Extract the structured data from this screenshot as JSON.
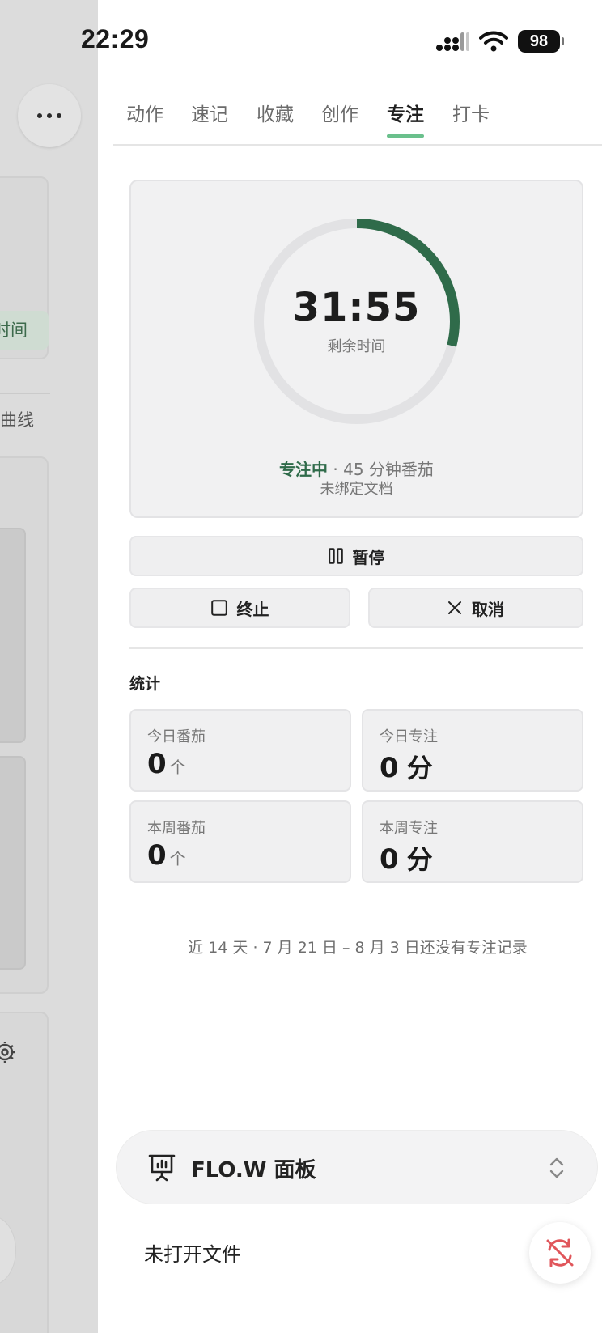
{
  "status_bar": {
    "time": "22:29",
    "battery": "98"
  },
  "background": {
    "chip_text": "时间",
    "label_text": "曲线"
  },
  "tabs": [
    {
      "label": "动作",
      "active": false
    },
    {
      "label": "速记",
      "active": false
    },
    {
      "label": "收藏",
      "active": false
    },
    {
      "label": "创作",
      "active": false
    },
    {
      "label": "专注",
      "active": true
    },
    {
      "label": "打卡",
      "active": false
    }
  ],
  "timer": {
    "remaining": "31:55",
    "remaining_label": "剩余时间",
    "progress_fraction": 0.29,
    "status_active": "专注中",
    "status_rest": " · 45 分钟番茄",
    "bound_doc": "未绑定文档"
  },
  "buttons": {
    "pause": "暂停",
    "stop": "终止",
    "cancel": "取消"
  },
  "stats": {
    "title": "统计",
    "items": [
      {
        "label": "今日番茄",
        "value": "0",
        "unit": "个"
      },
      {
        "label": "今日专注",
        "value": "0",
        "unit": "分"
      },
      {
        "label": "本周番茄",
        "value": "0",
        "unit": "个"
      },
      {
        "label": "本周专注",
        "value": "0",
        "unit": "分"
      }
    ]
  },
  "empty_note": "近 14 天 · 7 月 21 日 – 8 月 3 日还没有专注记录",
  "panel": {
    "title": "FLO.W 面板",
    "no_file": "未打开文件"
  },
  "colors": {
    "accent": "#2f6b4a",
    "tab_indicator": "#6ac08c",
    "ring_track": "#e2e2e4",
    "sync_icon": "#e0565b"
  }
}
